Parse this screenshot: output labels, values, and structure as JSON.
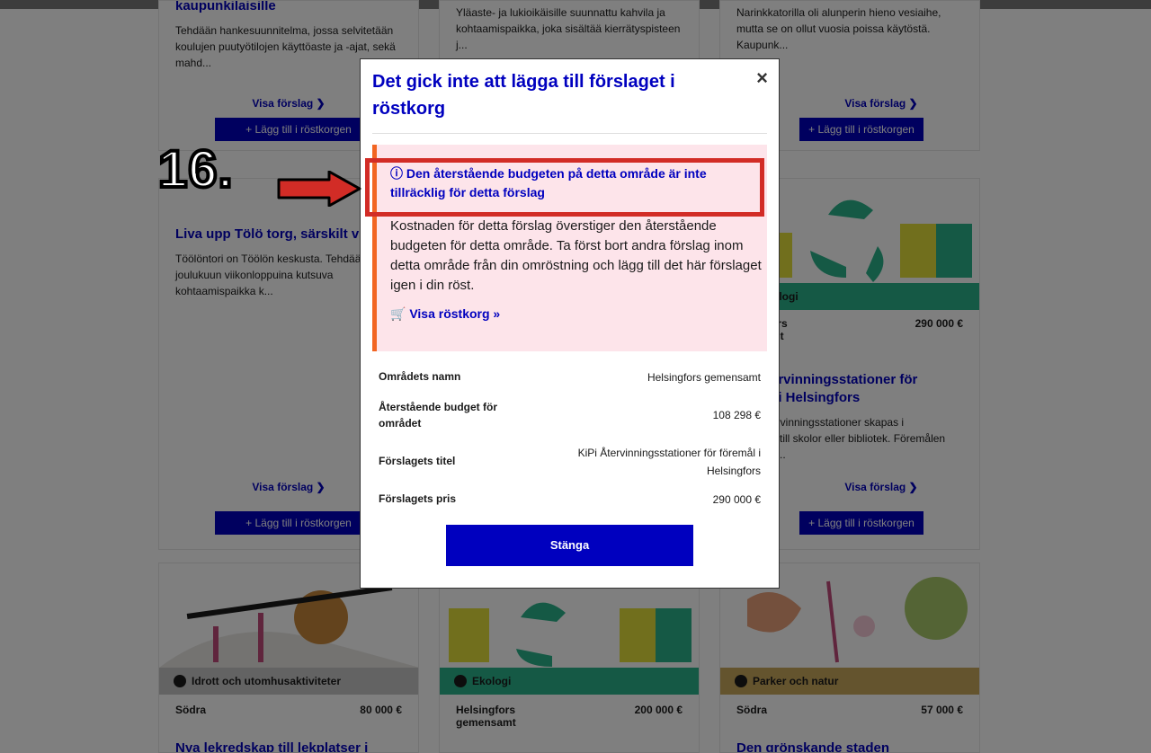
{
  "cards": {
    "c1": {
      "title": "kaupunkilaisille",
      "desc": "Tehdään hankesuunnitelma, jossa selvitetään koulujen puutyötilojen käyttöaste ja -ajat, sekä mahd...",
      "more": "Visa förslag ❯",
      "add": "+ Lägg till i röstkorgen"
    },
    "c2": {
      "desc": "Yläaste- ja lukioikäisille suunnattu kahvila ja kohtaamispaikka, joka sisältää kierrätyspisteen j..."
    },
    "c3": {
      "desc": "Narinkkatorilla oli alunperin hieno vesiaihe, mutta se on ollut vuosia poissa käytöstä. Kaupunk...",
      "more": "Visa förslag ❯",
      "add": "+ Lägg till i röstkorgen"
    },
    "c4": {
      "title": "Liva upp Tölö torg, särskilt vid",
      "desc": "Töölöntori on Töölön keskusta. Tehdää joulukuun viikonloppuina kutsuva kohtaamispaikka k...",
      "more": "Visa förslag ❯",
      "add": "+ Lägg till i röstkorgen"
    },
    "c6": {
      "tag": "ologi",
      "area": "ors",
      "area2": "mt",
      "price": "290 000 €",
      "title": "ervinningsstationer för",
      "title2": "l i Helsingfors",
      "desc": "ervinningsstationer skapas i",
      "desc2": "g till skolor eller bibliotek. Föremålen",
      "desc3": "a...",
      "more": "Visa förslag ❯",
      "add": "+ Lägg till i röstkorgen"
    },
    "c7": {
      "tag": "Idrott och utomhusaktiviteter",
      "area": "Södra",
      "price": "80 000 €",
      "title": "Nya lekredskap till lekplatser i"
    },
    "c8": {
      "tag": "Ekologi",
      "area": "Helsingfors",
      "area2": "gemensamt",
      "price": "200 000 €"
    },
    "c9": {
      "tag": "Parker och natur",
      "area": "Södra",
      "price": "57 000 €",
      "title": "Den grönskande staden"
    }
  },
  "modal": {
    "title": "Det gick inte att lägga till förslaget i röstkorg",
    "close_icon": "×",
    "alert_head": "ⓘ Den återstående budgeten på detta område är inte tillräcklig för detta förslag",
    "alert_body": "Kostnaden för detta förslag överstiger den återstående budgeten för detta område. Ta först bort andra förslag inom detta område från din omröstning och lägg till det här förslaget igen i din röst.",
    "alert_link": "🛒 Visa röstkorg »",
    "rows": [
      {
        "k": "Områdets namn",
        "v": "Helsingfors gemensamt"
      },
      {
        "k": "Återstående budget för området",
        "v": "108 298 €"
      },
      {
        "k": "Förslagets titel",
        "v": "KiPi Återvinningsstationer för föremål i Helsingfors"
      },
      {
        "k": "Förslagets pris",
        "v": "290 000 €"
      }
    ],
    "close_button": "Stänga"
  },
  "annotation": {
    "number": "16."
  },
  "colors": {
    "accent": "#0000bf",
    "alert_bg": "#fde4ea",
    "alert_border": "#f26522",
    "ecology": "#2bb38a",
    "sport": "#c7c7c7",
    "park": "#c9a85c",
    "highlight": "#d22c26"
  }
}
